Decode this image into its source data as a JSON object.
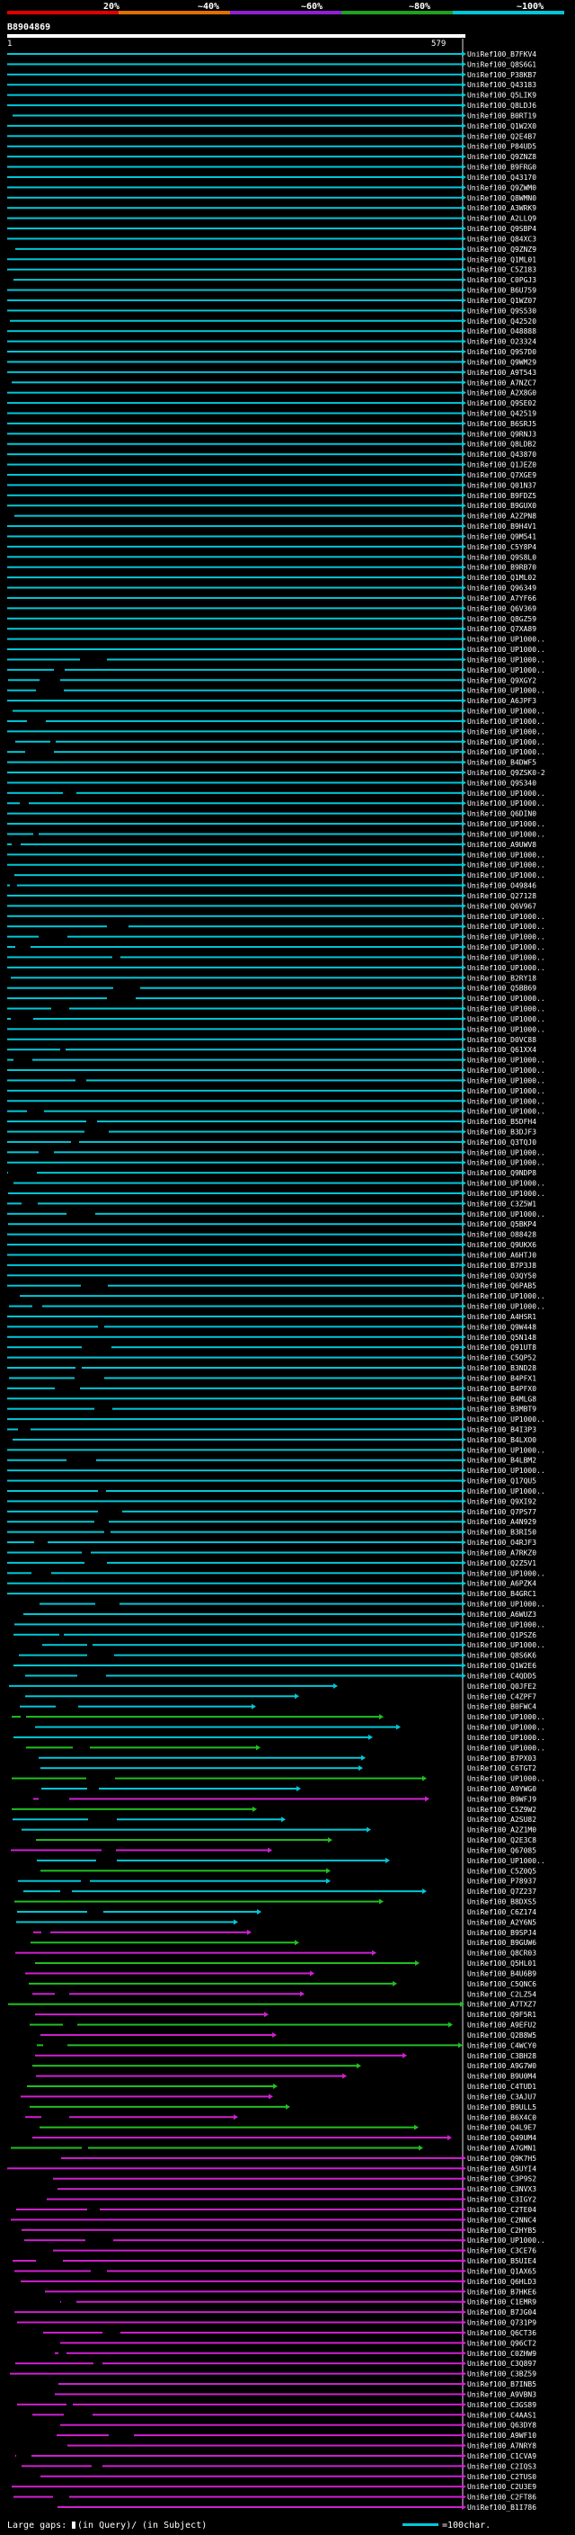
{
  "colors": {
    "background": "#000000",
    "teal": "#00c8d8",
    "green": "#20c020",
    "magenta": "#d020d0",
    "black_gap": "#000000",
    "dark_gap": "#505050",
    "text": "#ffffff",
    "query_bar": "#ffffff",
    "scale": [
      "#e00000",
      "#e07000",
      "#9020d0",
      "#20a020",
      "#00c8d8"
    ]
  },
  "header": {
    "scale_labels": [
      "20%",
      "~40%",
      "~60%",
      "~80%",
      "~100%"
    ],
    "query_id": "B8904869",
    "ruler_start": "1",
    "ruler_end": "579"
  },
  "hit_labels": [
    "UniRef100_B7FKV4",
    "UniRef100_Q8S6G1",
    "UniRef100_P38KB7",
    "UniRef100_Q43183",
    "UniRef100_Q5LIK9",
    "UniRef100_Q8LDJ6",
    "UniRef100_B0RT19",
    "UniRef100_Q1W2X0",
    "UniRef100_Q2E4B7",
    "UniRef100_P84UD5",
    "UniRef100_Q9ZNZ8",
    "UniRef100_B9FRG0",
    "UniRef100_Q43170",
    "UniRef100_Q9ZWM0",
    "UniRef100_Q8WMN0",
    "UniRef100_A3WRK9",
    "UniRef100_A2LLQ9",
    "UniRef100_Q9SBP4",
    "UniRef100_Q84XC3",
    "UniRef100_Q9ZNZ9",
    "UniRef100_Q1ML01",
    "UniRef100_C5Z183",
    "UniRef100_C0PGJ3",
    "UniRef100_B6U759",
    "UniRef100_Q1WZ07",
    "UniRef100_Q9S530",
    "UniRef100_Q42520",
    "UniRef100_O48888",
    "UniRef100_O23324",
    "UniRef100_Q9S7D0",
    "UniRef100_Q9WM29",
    "UniRef100_A9T543",
    "UniRef100_A7NZC7",
    "UniRef100_A2X8G0",
    "UniRef100_Q9SE02",
    "UniRef100_Q42519",
    "UniRef100_B6SRJ5",
    "UniRef100_Q9RNJ3",
    "UniRef100_Q8LDB2",
    "UniRef100_Q43870",
    "UniRef100_Q1JEZ0",
    "UniRef100_Q7XGE9",
    "UniRef100_Q01N37",
    "UniRef100_B9FDZ5",
    "UniRef100_B9GUX0",
    "UniRef100_A2ZPN8",
    "UniRef100_B9H4V1",
    "UniRef100_Q9M541",
    "UniRef100_C5Y8P4",
    "UniRef100_Q9S8L0",
    "UniRef100_B9RB70",
    "UniRef100_Q1ML02",
    "UniRef100_Q96349",
    "UniRef100_A7YF66",
    "UniRef100_Q6V369",
    "UniRef100_Q8GZ59",
    "UniRef100_Q7XA89",
    "UniRef100_UP1000..",
    "UniRef100_UP1000..",
    "UniRef100_UP1000..",
    "UniRef100_UP1000..",
    "UniRef100_Q9XGY2",
    "UniRef100_UP1000..",
    "UniRef100_A6JPF3",
    "UniRef100_UP1000..",
    "UniRef100_UP1000..",
    "UniRef100_UP1000..",
    "UniRef100_UP1000..",
    "UniRef100_UP1000..",
    "UniRef100_B4DWF5",
    "UniRef100_Q9ZSK0-2",
    "UniRef100_Q9S340",
    "UniRef100_UP1000..",
    "UniRef100_UP1000..",
    "UniRef100_Q6DIN0",
    "UniRef100_UP1000..",
    "UniRef100_UP1000..",
    "UniRef100_A9UWV8",
    "UniRef100_UP1000..",
    "UniRef100_UP1000..",
    "UniRef100_UP1000..",
    "UniRef100_O49846",
    "UniRef100_Q27128",
    "UniRef100_Q6V967",
    "UniRef100_UP1000..",
    "UniRef100_UP1000..",
    "UniRef100_UP1000..",
    "UniRef100_UP1000..",
    "UniRef100_UP1000..",
    "UniRef100_UP1000..",
    "UniRef100_B2RY18",
    "UniRef100_Q5BB69",
    "UniRef100_UP1000..",
    "UniRef100_UP1000..",
    "UniRef100_UP1000..",
    "UniRef100_UP1000..",
    "UniRef100_D0VC88",
    "UniRef100_Q61XX4",
    "UniRef100_UP1000..",
    "UniRef100_UP1000..",
    "UniRef100_UP1000..",
    "UniRef100_UP1000..",
    "UniRef100_UP1000..",
    "UniRef100_UP1000..",
    "UniRef100_B5DFH4",
    "UniRef100_B3DJF3",
    "UniRef100_Q3TQJ0",
    "UniRef100_UP1000..",
    "UniRef100_UP1000..",
    "UniRef100_Q9NDP8",
    "UniRef100_UP1000..",
    "UniRef100_UP1000..",
    "UniRef100_C3Z5W1",
    "UniRef100_UP1000..",
    "UniRef100_Q5BKP4",
    "UniRef100_O88428",
    "UniRef100_Q9UKX6",
    "UniRef100_A6HTJ0",
    "UniRef100_B7P3J8",
    "UniRef100_O3QY50",
    "UniRef100_Q6PAB5",
    "UniRef100_UP1000..",
    "UniRef100_UP1000..",
    "UniRef100_A4HSR1",
    "UniRef100_Q9W448",
    "UniRef100_Q5N148",
    "UniRef100_Q91UT8",
    "UniRef100_C5QP52",
    "UniRef100_B3ND28",
    "UniRef100_B4PFX1",
    "UniRef100_B4PFX0",
    "UniRef100_B4MLG8",
    "UniRef100_B3MBT9",
    "UniRef100_UP1000..",
    "UniRef100_B4I3P3",
    "UniRef100_B4LXO0",
    "UniRef100_UP1000..",
    "UniRef100_B4LBM2",
    "UniRef100_UP1000..",
    "UniRef100_Q17QU5",
    "UniRef100_UP1000..",
    "UniRef100_Q9XI92",
    "UniRef100_Q7PS77",
    "UniRef100_A4N929",
    "UniRef100_B3RI50",
    "UniRef100_O4RJF3",
    "UniRef100_A7RKZ0",
    "UniRef100_Q2Z5V1",
    "UniRef100_UP1000..",
    "UniRef100_A6PZK4",
    "UniRef100_B4GRC1",
    "UniRef100_UP1000..",
    "UniRef100_A6WUZ3",
    "UniRef100_UP1000..",
    "UniRef100_Q1PSZ6",
    "UniRef100_UP1000..",
    "UniRef100_Q8S6K6",
    "UniRef100_Q1W2E6",
    "UniRef100_C4QDD5",
    "UniRef100_Q0JFE2",
    "UniRef100_C4ZPF7",
    "UniRef100_B0FWC4",
    "UniRef100_UP1000..",
    "UniRef100_UP1000..",
    "UniRef100_UP1000..",
    "UniRef100_UP1000..",
    "UniRef100_B7PX03",
    "UniRef100_C6TGT2",
    "UniRef100_UP1000..",
    "UniRef100_A9YWG0",
    "UniRef100_B9WFJ9",
    "UniRef100_C5Z9W2",
    "UniRef100_A2SU82",
    "UniRef100_A2Z1M0",
    "UniRef100_Q2E3C8",
    "UniRef100_Q67085",
    "UniRef100_UP1000..",
    "UniRef100_C5Z0Q5",
    "UniRef100_P78937",
    "UniRef100_Q7Z237",
    "UniRef100_B8DXS5",
    "UniRef100_C6Z174",
    "UniRef100_A2Y6N5",
    "UniRef100_B9SPJ4",
    "UniRef100_B9GUW6",
    "UniRef100_Q8CR03",
    "UniRef100_Q5HL01",
    "UniRef100_B4U6B9",
    "UniRef100_C5QNC6",
    "UniRef100_C2LZ54",
    "UniRef100_A7TXZ7",
    "UniRef100_Q9F5R1",
    "UniRef100_A9EFU2",
    "UniRef100_Q2B8W5",
    "UniRef100_C4WCY0",
    "UniRef100_C3BH28",
    "UniRef100_A9G7W0",
    "UniRef100_B9U0M4",
    "UniRef100_C4TUD1",
    "UniRef100_C3AJU7",
    "UniRef100_B9ULL5",
    "UniRef100_B6X4C0",
    "UniRef100_Q4L9E7",
    "UniRef100_Q49UM4",
    "UniRef100_A7GMN1",
    "UniRef100_Q9K7H5",
    "UniRef100_A5UYI4",
    "UniRef100_C3P9S2",
    "UniRef100_C3NVX3",
    "UniRef100_C3IGY2",
    "UniRef100_C2TE04",
    "UniRef100_C2NNC4",
    "UniRef100_C2HYB5",
    "UniRef100_UP1000..",
    "UniRef100_C3CE76",
    "UniRef100_B5UIE4",
    "UniRef100_Q1AX65",
    "UniRef100_Q6HLD3",
    "UniRef100_B7HKE6",
    "UniRef100_C1EMR9",
    "UniRef100_B7JG04",
    "UniRef100_Q731P9",
    "UniRef100_Q6CT36",
    "UniRef100_Q96CT2",
    "UniRef100_C0ZHW9",
    "UniRef100_C3Q897",
    "UniRef100_C3BZ59",
    "UniRef100_B7INB5",
    "UniRef100_A9VBN3",
    "UniRef100_C3GS89",
    "UniRef100_C4AAS1",
    "UniRef100_Q63DY8",
    "UniRef100_A9WF10",
    "UniRef100_A7NRY8",
    "UniRef100_C1CVA9",
    "UniRef100_C2IQS3",
    "UniRef100_C2TUS0",
    "UniRef100_C2U3E9",
    "UniRef100_C2FT86",
    "UniRef100_B1I786"
  ],
  "footer": {
    "large_gaps_label": "Large gaps:",
    "in_query_label": "(in Query)/",
    "in_subject_label": "(in Subject)",
    "legend_label": "=100char."
  }
}
